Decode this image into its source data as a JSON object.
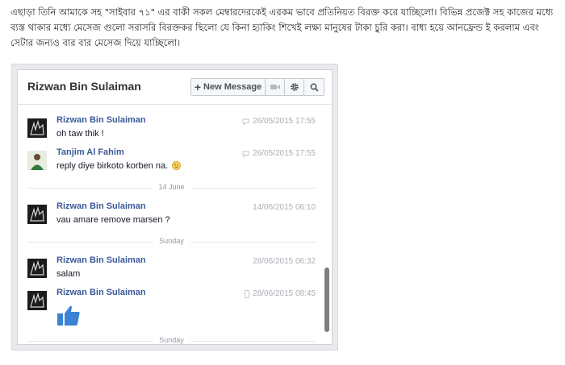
{
  "article": {
    "paragraph": "এছাড়া তিনি আমাকে সহ \"সাইবার ৭১\" এর বাকী সকল মেম্বারদেরকেই এরকম ভাবে প্রতিনিয়ত বিরক্ত করে যাচ্ছিলো। বিভিন্ন প্রজেক্ট সহ কাজের মধ্যে ব্যস্ত থাকার মধ্যে মেসেজ গুলো সরাসরি বিরক্তকর ছিলো যে কিনা হ্যাকিং শিখেই লক্ষ্য মানুষের টাকা চুরি করা। বাধ্য হয়ে আনফ্রেন্ড ই করলাম এবং সেটার জন্যও বার বার মেসেজ দিয়ে যাচ্ছিলো।"
  },
  "chat": {
    "title": "Rizwan Bin Sulaiman",
    "toolbar": {
      "new_message_label": "New Message",
      "icons": [
        "video-icon",
        "gear-icon",
        "search-icon"
      ]
    },
    "messages": [
      {
        "sender": "Rizwan Bin Sulaiman",
        "text": "oh taw thik !",
        "time": "26/05/2015 17:55",
        "source_icon": "chat-bubble-icon"
      },
      {
        "sender": "Tanjim Al Fahim",
        "text": "reply diye birkoto korben na.",
        "time": "26/05/2015 17:55",
        "source_icon": "chat-bubble-icon",
        "emoji": "smile-emoji"
      },
      {
        "sender": "Rizwan Bin Sulaiman",
        "text": "vau amare remove marsen ?",
        "time": "14/06/2015 06:10"
      },
      {
        "sender": "Rizwan Bin Sulaiman",
        "text": "salam",
        "time": "28/06/2015 06:32"
      },
      {
        "sender": "Rizwan Bin Sulaiman",
        "text": "",
        "time": "28/06/2015 08:45",
        "source_icon": "mobile-icon",
        "sticker": "thumbs-up-icon"
      }
    ],
    "separators": [
      "14 June",
      "Sunday",
      "Sunday"
    ],
    "colors": {
      "name": "#3b5998",
      "time": "#aaaeb5",
      "like": "#3b82d6"
    }
  }
}
